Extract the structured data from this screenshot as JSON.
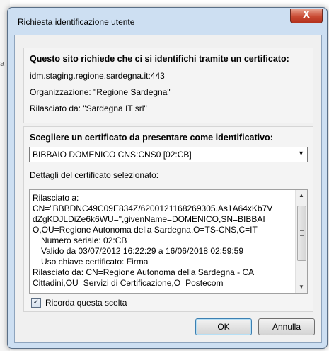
{
  "background": {
    "side_text": "a"
  },
  "dialog": {
    "title": "Richiesta identificazione utente",
    "close_glyph": "X"
  },
  "request": {
    "heading": "Questo sito richiede che ci si identifichi tramite un certificato:",
    "host": "idm.staging.regione.sardegna.it:443",
    "organization": "Organizzazione: \"Regione Sardegna\"",
    "issuer": "Rilasciato da: \"Sardegna IT srl\""
  },
  "certificate": {
    "choose_heading": "Scegliere un certificato da presentare come identificativo:",
    "selected": "BIBBAIO DOMENICO CNS:CNS0 [02:CB]",
    "details_label": "Dettagli del certificato selezionato:",
    "details_lines": [
      "Rilasciato a:",
      "CN=\"BBBDNC49C09E834Z/6200121168269305.As1A64xKb7V",
      "dZgKDJLDiZe6k6WU=\",givenName=DOMENICO,SN=BIBBAI",
      "O,OU=Regione Autonoma della Sardegna,O=TS-CNS,C=IT",
      "Numero seriale: 02:CB",
      "Valido da 03/07/2012 16:22:29 a 16/06/2018 02:59:59",
      "Uso chiave certificato: Firma",
      "Rilasciato da: CN=Regione Autonoma della Sardegna - CA",
      "Cittadini,OU=Servizi di Certificazione,O=Postecom"
    ],
    "remember_label": "Ricorda questa scelta",
    "remember_checked": true
  },
  "buttons": {
    "ok": "OK",
    "cancel": "Annulla"
  },
  "colors": {
    "titlebar": "#cddff2",
    "close": "#c94a33",
    "ok_focus": "#3c7fb1"
  },
  "icons": {
    "close": "close-icon",
    "dropdown": "chevron-down-icon",
    "scroll_up": "arrow-up-icon",
    "scroll_down": "arrow-down-icon",
    "check": "check-icon"
  }
}
